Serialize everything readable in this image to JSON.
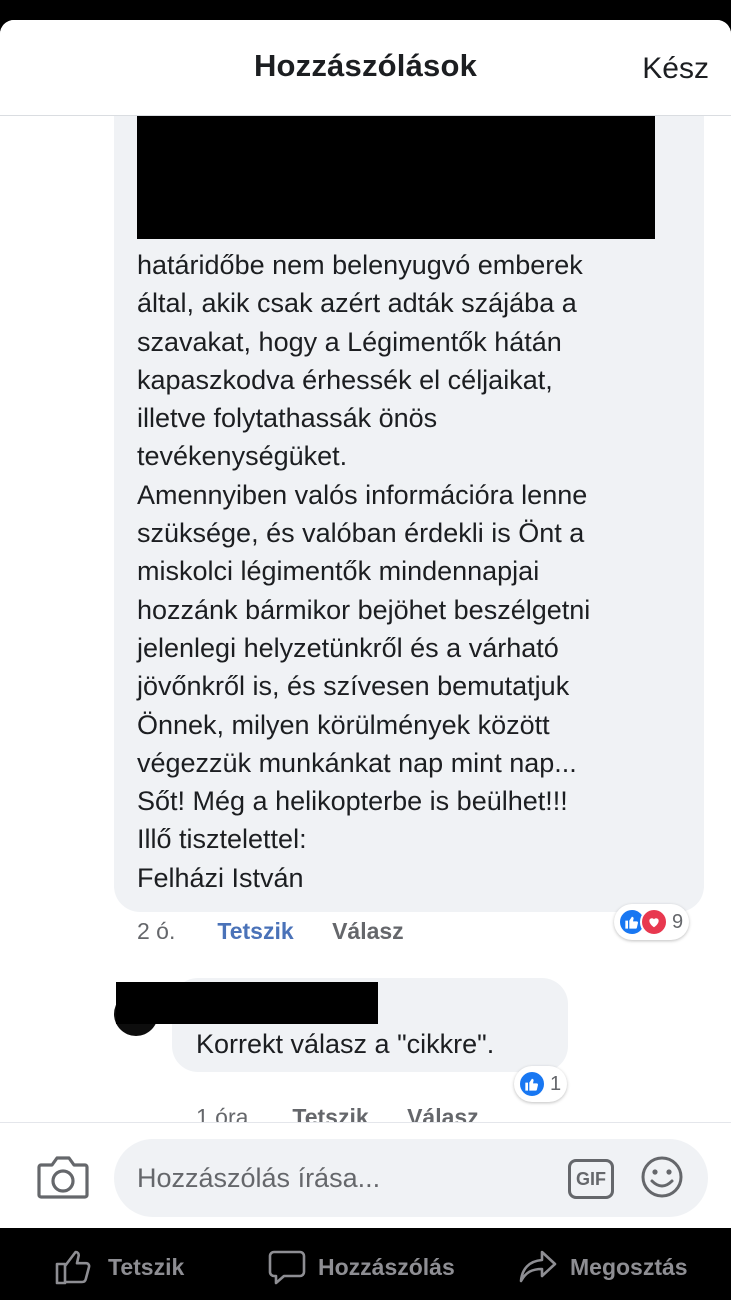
{
  "header": {
    "title": "Hozzászólások",
    "done_label": "Kész"
  },
  "comments": [
    {
      "text": "határidőbe nem belenyugvó emberek\náltal, akik csak azért adták szájába a\nszavakat, hogy a Légimentők hátán\nkapaszkodva érhessék el céljaikat,\nilletve folytathassák önös\ntevékenységüket.\nAmennyiben valós információra lenne\nszüksége, és valóban érdekli is Önt a\nmiskolci légimentők mindennapjai\nhozzánk bármikor bejöhet beszélgetni\njelenlegi helyzetünkről és a várható\njövőnkről is, és szívesen bemutatjuk\nÖnnek, milyen körülmények között\nvégezzük munkánkat nap mint nap...\nSőt! Még a helikopterbe is beülhet!!!\nIllő tisztelettel:\nFelházi István",
      "time": "2 ó.",
      "like_label": "Tetszik",
      "reply_label": "Válasz",
      "reactions": [
        "like-icon",
        "love-icon"
      ],
      "reaction_count": "9",
      "like_active_color": "#4a72b8"
    },
    {
      "text": "Korrekt válasz a \"cikkre\".",
      "time": "1 óra",
      "like_label": "Tetszik",
      "reply_label": "Válasz",
      "reactions": [
        "like-icon"
      ],
      "reaction_count": "1"
    }
  ],
  "composer": {
    "placeholder": "Hozzászólás írása...",
    "gif_label": "GIF"
  },
  "bottom_bar": {
    "like_label": "Tetszik",
    "comment_label": "Hozzászólás",
    "share_label": "Megosztás"
  }
}
